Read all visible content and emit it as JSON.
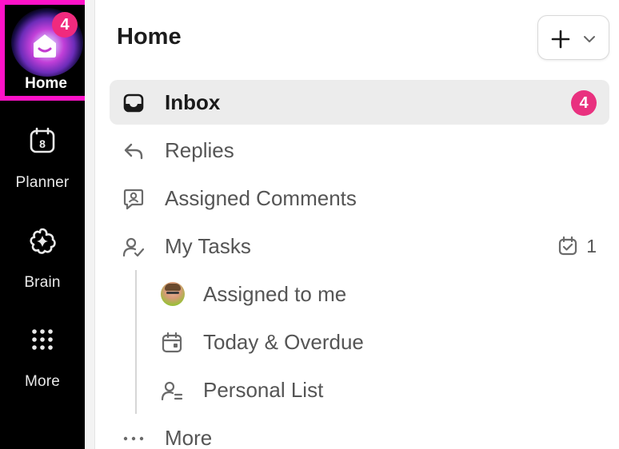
{
  "rail": {
    "home": {
      "label": "Home",
      "badge": "4"
    },
    "planner": {
      "label": "Planner",
      "icon": "calendar-8-icon"
    },
    "brain": {
      "label": "Brain",
      "icon": "brain-icon"
    },
    "more": {
      "label": "More",
      "icon": "grid-dots-icon"
    }
  },
  "header": {
    "title": "Home"
  },
  "nav": {
    "inbox": {
      "label": "Inbox",
      "badge": "4"
    },
    "replies": {
      "label": "Replies"
    },
    "assigned_comments": {
      "label": "Assigned Comments"
    },
    "my_tasks": {
      "label": "My Tasks",
      "count": "1"
    },
    "assigned_to_me": {
      "label": "Assigned to me"
    },
    "today_overdue": {
      "label": "Today & Overdue"
    },
    "personal_list": {
      "label": "Personal List"
    },
    "more": {
      "label": "More"
    }
  },
  "colors": {
    "accent_badge": "#e9317f",
    "selection_outline": "#ff12c8",
    "rail_bg": "#000000"
  }
}
